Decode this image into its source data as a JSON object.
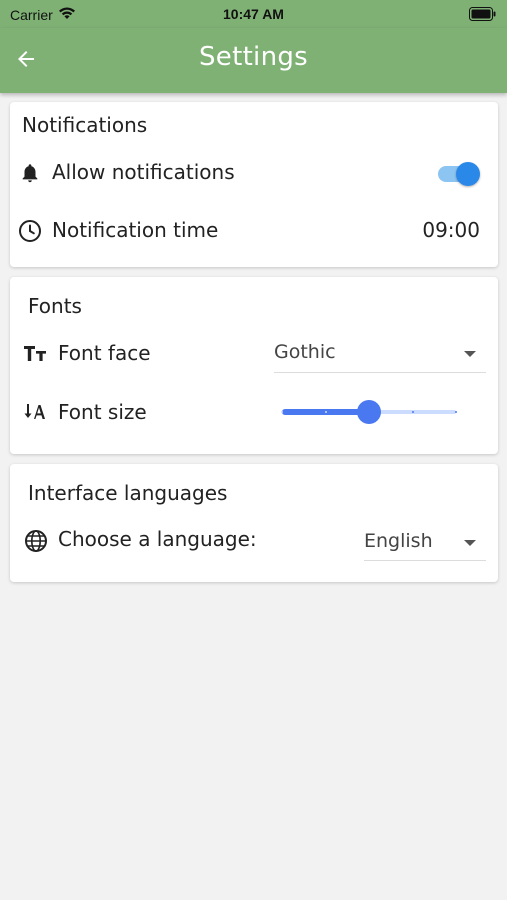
{
  "status_bar": {
    "carrier": "Carrier",
    "time": "10:47 AM"
  },
  "app_bar": {
    "title": "Settings"
  },
  "notifications": {
    "title": "Notifications",
    "allow_label": "Allow notifications",
    "allow_enabled": true,
    "time_label": "Notification time",
    "time_value": "09:00"
  },
  "fonts": {
    "title": "Fonts",
    "face_label": "Font face",
    "face_value": "Gothic",
    "size_label": "Font size",
    "size_level": 0.5,
    "size_steps": 4
  },
  "languages": {
    "title": "Interface languages",
    "choose_label": "Choose a language:",
    "language_value": "English"
  },
  "colors": {
    "app_bar": "#7fb175",
    "toggle_thumb": "#2a88e8",
    "toggle_track": "#8cc4f2",
    "slider_active": "#4a78f0",
    "slider_inactive": "#cbdcff"
  },
  "icons": [
    "wifi-icon",
    "battery-icon",
    "back-arrow-icon",
    "bell-icon",
    "clock-icon",
    "text-format-icon",
    "sort-font-size-icon",
    "globe-icon",
    "dropdown-arrow-icon"
  ]
}
